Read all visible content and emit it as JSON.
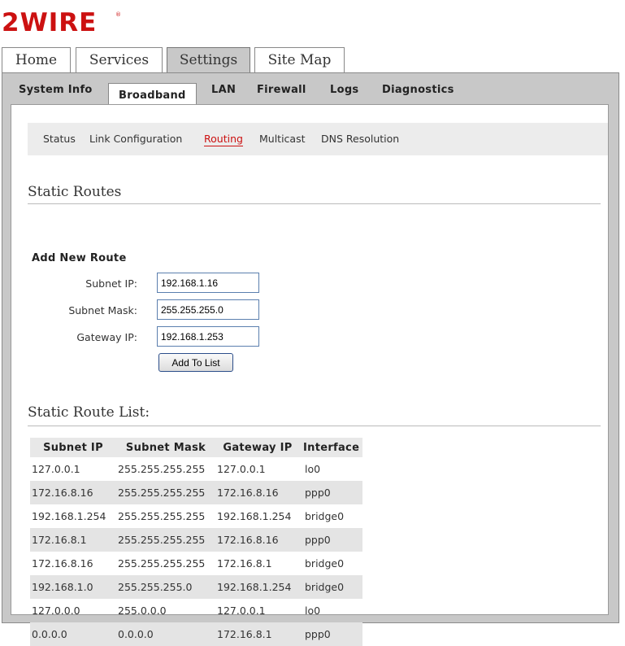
{
  "brand": {
    "logo_text": "2WIRE",
    "color": "#cc1111"
  },
  "top_tabs": [
    {
      "label": "Home",
      "active": false
    },
    {
      "label": "Services",
      "active": false
    },
    {
      "label": "Settings",
      "active": true
    },
    {
      "label": "Site Map",
      "active": false
    }
  ],
  "sub_tabs": [
    {
      "label": "System Info",
      "active": false
    },
    {
      "label": "Broadband",
      "active": true
    },
    {
      "label": "LAN",
      "active": false
    },
    {
      "label": "Firewall",
      "active": false
    },
    {
      "label": "Logs",
      "active": false
    },
    {
      "label": "Diagnostics",
      "active": false
    }
  ],
  "sub_nav": [
    {
      "label": "Status",
      "active": false
    },
    {
      "label": "Link Configuration",
      "active": false
    },
    {
      "label": "Routing",
      "active": true
    },
    {
      "label": "Multicast",
      "active": false
    },
    {
      "label": "DNS Resolution",
      "active": false
    }
  ],
  "static_routes": {
    "title": "Static Routes",
    "form_title": "Add New Route",
    "fields": [
      {
        "label": "Subnet IP:",
        "value": "192.168.1.16"
      },
      {
        "label": "Subnet Mask:",
        "value": "255.255.255.0"
      },
      {
        "label": "Gateway IP:",
        "value": "192.168.1.253"
      }
    ],
    "add_button": "Add To List"
  },
  "route_list": {
    "title": "Static Route List:",
    "headers": [
      "Subnet IP",
      "Subnet Mask",
      "Gateway IP",
      "Interface"
    ],
    "rows": [
      [
        "127.0.0.1",
        "255.255.255.255",
        "127.0.0.1",
        "lo0"
      ],
      [
        "172.16.8.16",
        "255.255.255.255",
        "172.16.8.16",
        "ppp0"
      ],
      [
        "192.168.1.254",
        "255.255.255.255",
        "192.168.1.254",
        "bridge0"
      ],
      [
        "172.16.8.1",
        "255.255.255.255",
        "172.16.8.16",
        "ppp0"
      ],
      [
        "172.16.8.16",
        "255.255.255.255",
        "172.16.8.1",
        "bridge0"
      ],
      [
        "192.168.1.0",
        "255.255.255.0",
        "192.168.1.254",
        "bridge0"
      ],
      [
        "127.0.0.0",
        "255.0.0.0",
        "127.0.0.1",
        "lo0"
      ],
      [
        "0.0.0.0",
        "0.0.0.0",
        "172.16.8.1",
        "ppp0"
      ]
    ]
  }
}
